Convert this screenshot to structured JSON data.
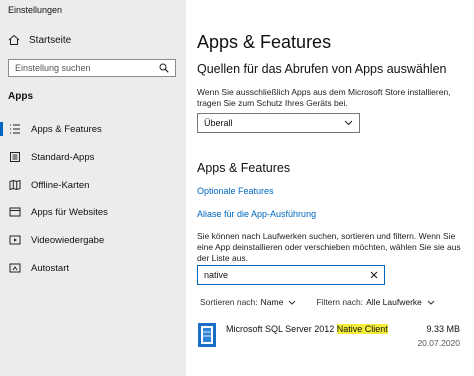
{
  "window": {
    "title": "Einstellungen"
  },
  "sidebar": {
    "home_label": "Startseite",
    "search_placeholder": "Einstellung suchen",
    "section_title": "Apps",
    "items": [
      {
        "label": "Apps & Features",
        "icon": "apps-features-icon",
        "selected": true
      },
      {
        "label": "Standard-Apps",
        "icon": "default-apps-icon",
        "selected": false
      },
      {
        "label": "Offline-Karten",
        "icon": "offline-maps-icon",
        "selected": false
      },
      {
        "label": "Apps für Websites",
        "icon": "apps-websites-icon",
        "selected": false
      },
      {
        "label": "Videowiedergabe",
        "icon": "video-playback-icon",
        "selected": false
      },
      {
        "label": "Autostart",
        "icon": "startup-icon",
        "selected": false
      }
    ]
  },
  "main": {
    "title": "Apps & Features",
    "sources": {
      "heading": "Quellen für das Abrufen von Apps auswählen",
      "description": "Wenn Sie ausschließlich Apps aus dem Microsoft Store installieren, tragen Sie zum Schutz Ihres Geräts bei.",
      "dropdown_value": "Überall"
    },
    "apps_section": {
      "heading": "Apps & Features",
      "link_optional": "Optionale Features",
      "link_aliases": "Aliase für die App-Ausführung",
      "description": "Sie können nach Laufwerken suchen, sortieren und filtern. Wenn Sie eine App deinstallieren oder verschieben möchten, wählen Sie sie aus der Liste aus.",
      "search_value": "native",
      "sort_label": "Sortieren nach:",
      "sort_value": "Name",
      "filter_label": "Filtern nach:",
      "filter_value": "Alle Laufwerke"
    },
    "apps": [
      {
        "name_prefix": "Microsoft SQL Server 2012 ",
        "name_match": "Native Client",
        "size": "9.33 MB",
        "date": "20.07.2020",
        "icon": "sql-server-icon"
      }
    ]
  },
  "colors": {
    "accent": "#0067c0",
    "highlight": "#f4ee3a",
    "sidebar_bg": "#ececec"
  }
}
